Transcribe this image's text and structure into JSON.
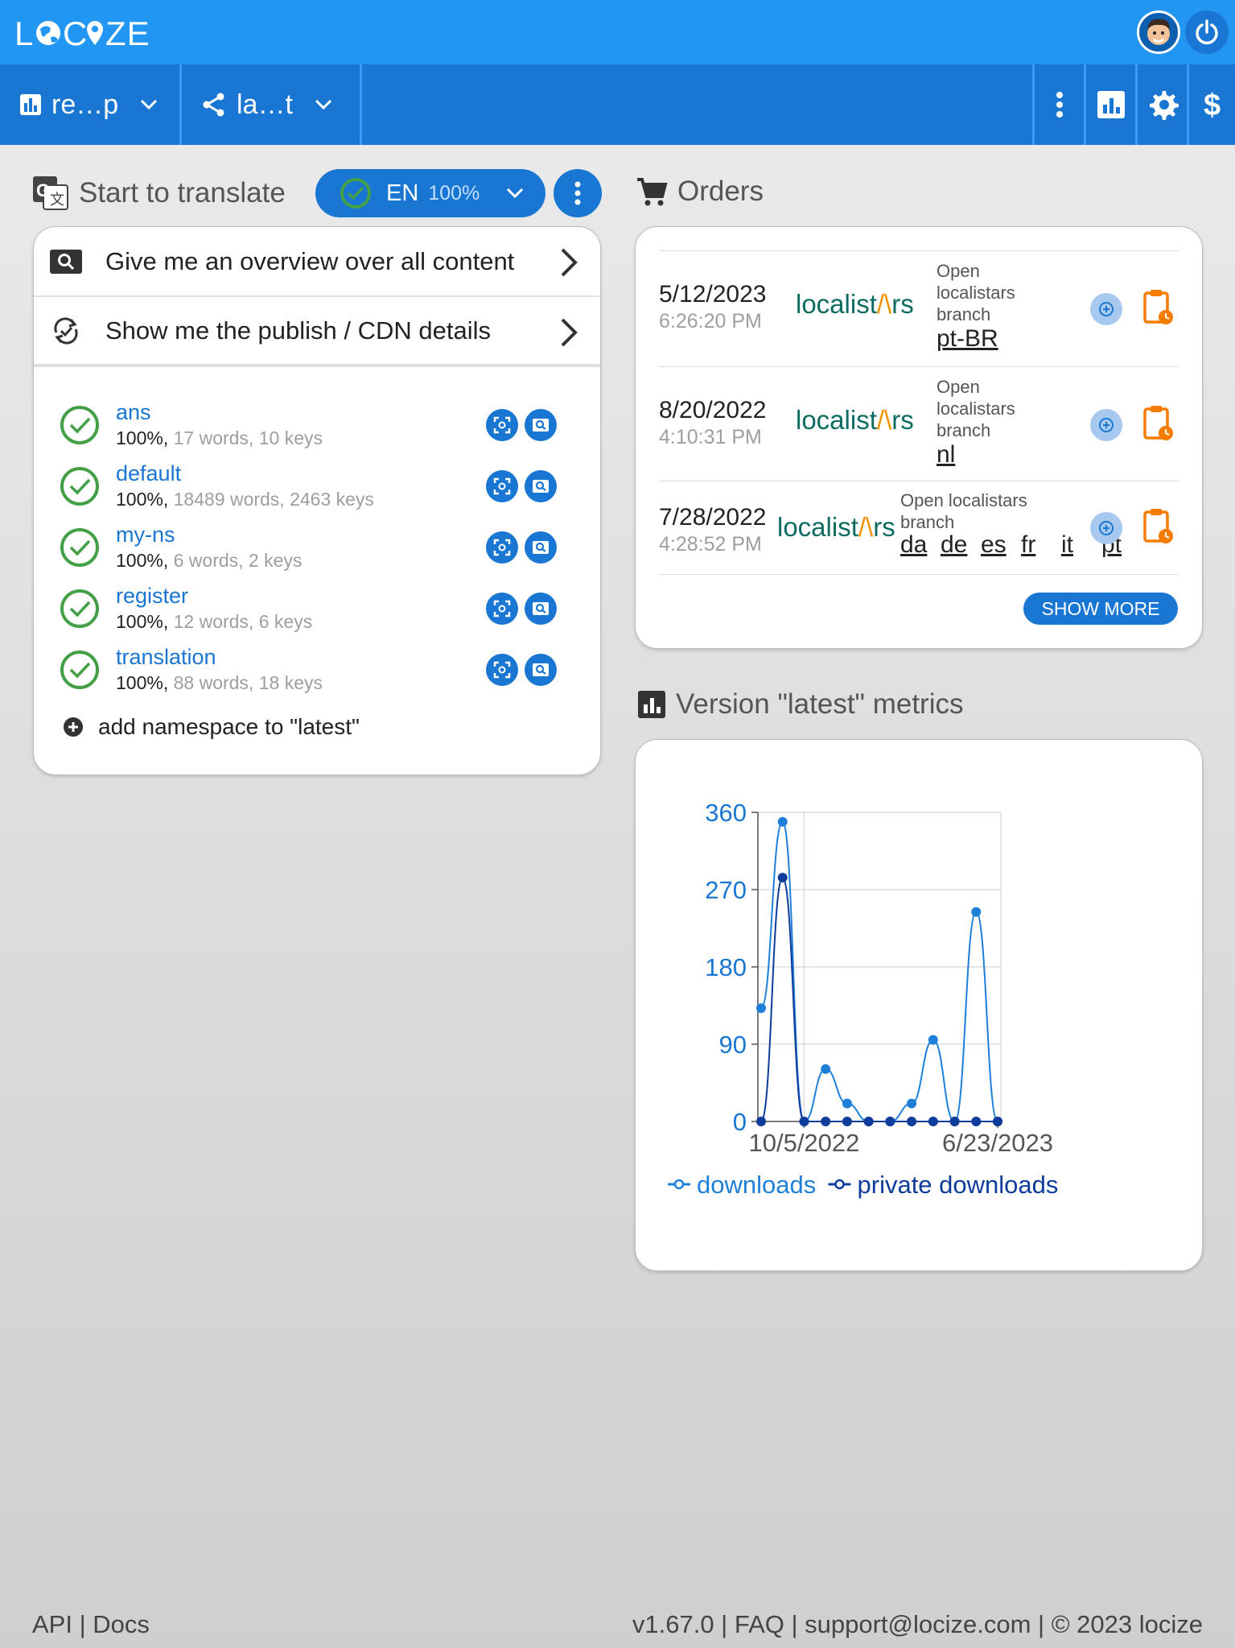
{
  "header": {
    "logo_text": "LOCIZE",
    "avatar_icon": "user-avatar",
    "power_icon": "power-icon"
  },
  "nav": {
    "project_label": "re…p",
    "version_label": "la…t",
    "more_icon": "more-vertical-icon",
    "stats_icon": "bar-chart-icon",
    "settings_icon": "gear-icon",
    "billing_icon": "dollar-icon"
  },
  "translate": {
    "title": "Start to translate",
    "language_code": "EN",
    "language_pct": "100%",
    "actions": [
      {
        "label": "Give me an overview over all content"
      },
      {
        "label": "Show me the publish / CDN details"
      }
    ],
    "namespaces": [
      {
        "name": "ans",
        "pct": "100%,",
        "detail": "17 words, 10 keys"
      },
      {
        "name": "default",
        "pct": "100%,",
        "detail": "18489 words, 2463 keys"
      },
      {
        "name": "my-ns",
        "pct": "100%,",
        "detail": "6 words, 2 keys"
      },
      {
        "name": "register",
        "pct": "100%,",
        "detail": "12 words, 6 keys"
      },
      {
        "name": "translation",
        "pct": "100%,",
        "detail": "88 words, 18 keys"
      }
    ],
    "add_namespace": "add namespace to \"latest\""
  },
  "orders": {
    "title": "Orders",
    "rows": [
      {
        "date": "5/12/2023",
        "time": "6:26:20 PM",
        "brand_a": "localist",
        "brand_b": "rs",
        "open_lines": [
          "Open",
          "localistars",
          "branch"
        ],
        "langs": [
          "pt-BR"
        ]
      },
      {
        "date": "8/20/2022",
        "time": "4:10:31 PM",
        "brand_a": "localist",
        "brand_b": "rs",
        "open_lines": [
          "Open",
          "localistars",
          "branch"
        ],
        "langs": [
          "nl"
        ]
      },
      {
        "date": "7/28/2022",
        "time": "4:28:52 PM",
        "brand_a": "localist",
        "brand_b": "rs",
        "open_lines": [
          "Open localistars",
          "branch"
        ],
        "langs": [
          "da",
          "de",
          "es",
          "fr",
          "it",
          "pt"
        ]
      }
    ],
    "show_more": "SHOW MORE"
  },
  "metrics": {
    "title": "Version \"latest\" metrics"
  },
  "chart_data": {
    "type": "line",
    "title": "",
    "xlabel": "",
    "ylabel": "",
    "x_tick_labels": [
      "10/5/2022",
      "6/23/2023"
    ],
    "ylim": [
      0,
      360
    ],
    "y_ticks": [
      "360",
      "270",
      "180",
      "90",
      "0"
    ],
    "grid": true,
    "legend_position": "bottom",
    "colors": {
      "downloads": "#1e7fd9",
      "private downloads": "#0d3c9b"
    },
    "series": [
      {
        "name": "downloads",
        "values": [
          132,
          349,
          0,
          61,
          21,
          0,
          0,
          21,
          95,
          0,
          244,
          0
        ]
      },
      {
        "name": "private downloads",
        "values": [
          0,
          284,
          0,
          0,
          0,
          0,
          0,
          0,
          0,
          0,
          0,
          0
        ]
      }
    ]
  },
  "footer": {
    "left": "API | Docs",
    "right": "v1.67.0 | FAQ | support@locize.com | © 2023 locize"
  }
}
